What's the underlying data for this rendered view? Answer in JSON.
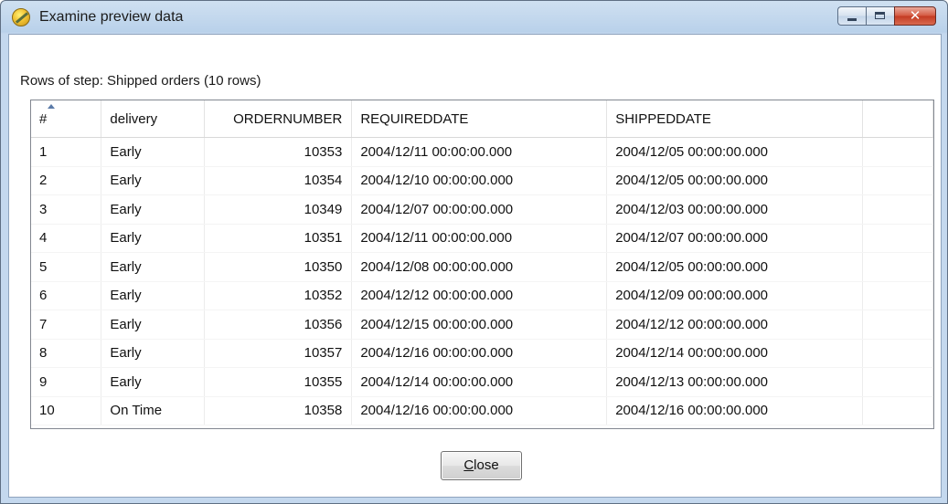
{
  "window": {
    "title": "Examine preview data",
    "icon": "kettle-app-icon",
    "controls": {
      "minimize": "minimize",
      "maximize": "maximize",
      "close": "✕"
    }
  },
  "step_label": "Rows of step: Shipped orders (10 rows)",
  "table": {
    "columns": [
      "#",
      "delivery",
      "ORDERNUMBER",
      "REQUIREDDATE",
      "SHIPPEDDATE"
    ],
    "rows": [
      [
        "1",
        "Early",
        "10353",
        "2004/12/11 00:00:00.000",
        "2004/12/05 00:00:00.000"
      ],
      [
        "2",
        "Early",
        "10354",
        "2004/12/10 00:00:00.000",
        "2004/12/05 00:00:00.000"
      ],
      [
        "3",
        "Early",
        "10349",
        "2004/12/07 00:00:00.000",
        "2004/12/03 00:00:00.000"
      ],
      [
        "4",
        "Early",
        "10351",
        "2004/12/11 00:00:00.000",
        "2004/12/07 00:00:00.000"
      ],
      [
        "5",
        "Early",
        "10350",
        "2004/12/08 00:00:00.000",
        "2004/12/05 00:00:00.000"
      ],
      [
        "6",
        "Early",
        "10352",
        "2004/12/12 00:00:00.000",
        "2004/12/09 00:00:00.000"
      ],
      [
        "7",
        "Early",
        "10356",
        "2004/12/15 00:00:00.000",
        "2004/12/12 00:00:00.000"
      ],
      [
        "8",
        "Early",
        "10357",
        "2004/12/16 00:00:00.000",
        "2004/12/14 00:00:00.000"
      ],
      [
        "9",
        "Early",
        "10355",
        "2004/12/14 00:00:00.000",
        "2004/12/13 00:00:00.000"
      ],
      [
        "10",
        "On Time",
        "10358",
        "2004/12/16 00:00:00.000",
        "2004/12/16 00:00:00.000"
      ]
    ]
  },
  "buttons": {
    "close_mnemonic": "C",
    "close_rest": "lose"
  }
}
